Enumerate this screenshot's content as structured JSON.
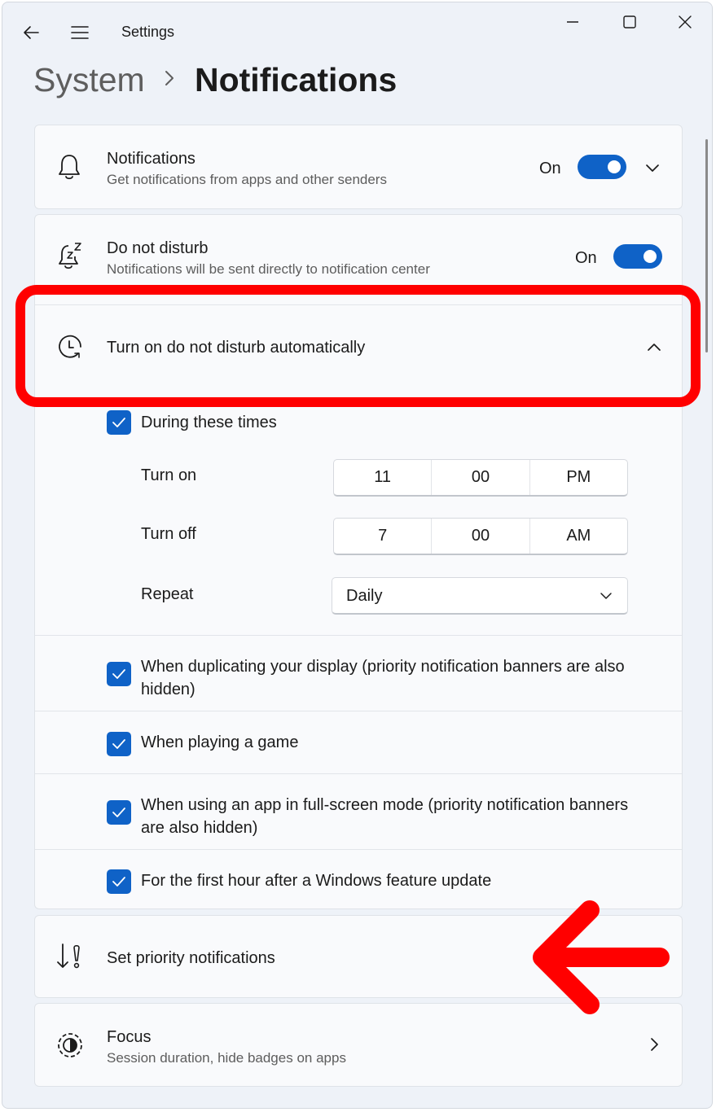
{
  "window": {
    "title": "Settings",
    "back_icon": "back-arrow-icon",
    "menu_icon": "hamburger-menu-icon",
    "minimize_icon": "minimize-icon",
    "maximize_icon": "maximize-icon",
    "close_icon": "close-icon"
  },
  "breadcrumb": {
    "parent": "System",
    "separator_icon": "chevron-right-icon",
    "current": "Notifications"
  },
  "notifications_row": {
    "icon": "bell-icon",
    "title": "Notifications",
    "subtitle": "Get notifications from apps and other senders",
    "state": "On",
    "toggle_on": true
  },
  "dnd_row": {
    "icon": "bell-snooze-icon",
    "title": "Do not disturb",
    "subtitle": "Notifications will be sent directly to notification center",
    "state": "On",
    "toggle_on": true
  },
  "auto_dnd_row": {
    "icon": "clock-icon",
    "title": "Turn on do not disturb automatically",
    "expanded": true
  },
  "schedule": {
    "during_label": "During these times",
    "during_checked": true,
    "turn_on_label": "Turn on",
    "turn_on": {
      "hour": "11",
      "minute": "00",
      "period": "PM"
    },
    "turn_off_label": "Turn off",
    "turn_off": {
      "hour": "7",
      "minute": "00",
      "period": "AM"
    },
    "repeat_label": "Repeat",
    "repeat_value": "Daily"
  },
  "conditions": [
    {
      "label": "When duplicating your display (priority notification banners are also hidden)",
      "checked": true
    },
    {
      "label": "When playing a game",
      "checked": true
    },
    {
      "label": "When using an app in full-screen mode (priority notification banners are also hidden)",
      "checked": true
    },
    {
      "label": "For the first hour after a Windows feature update",
      "checked": true
    }
  ],
  "priority_row": {
    "icon": "priority-sort-icon",
    "title": "Set priority notifications"
  },
  "focus_row": {
    "icon": "focus-timer-icon",
    "title": "Focus",
    "subtitle": "Session duration, hide badges on apps"
  },
  "annotations": {
    "highlight_color": "#ff0000",
    "arrow_color": "#ff0000"
  },
  "colors": {
    "accent": "#0f62c7",
    "background": "#eef2f8",
    "card": "#f9fafc"
  }
}
